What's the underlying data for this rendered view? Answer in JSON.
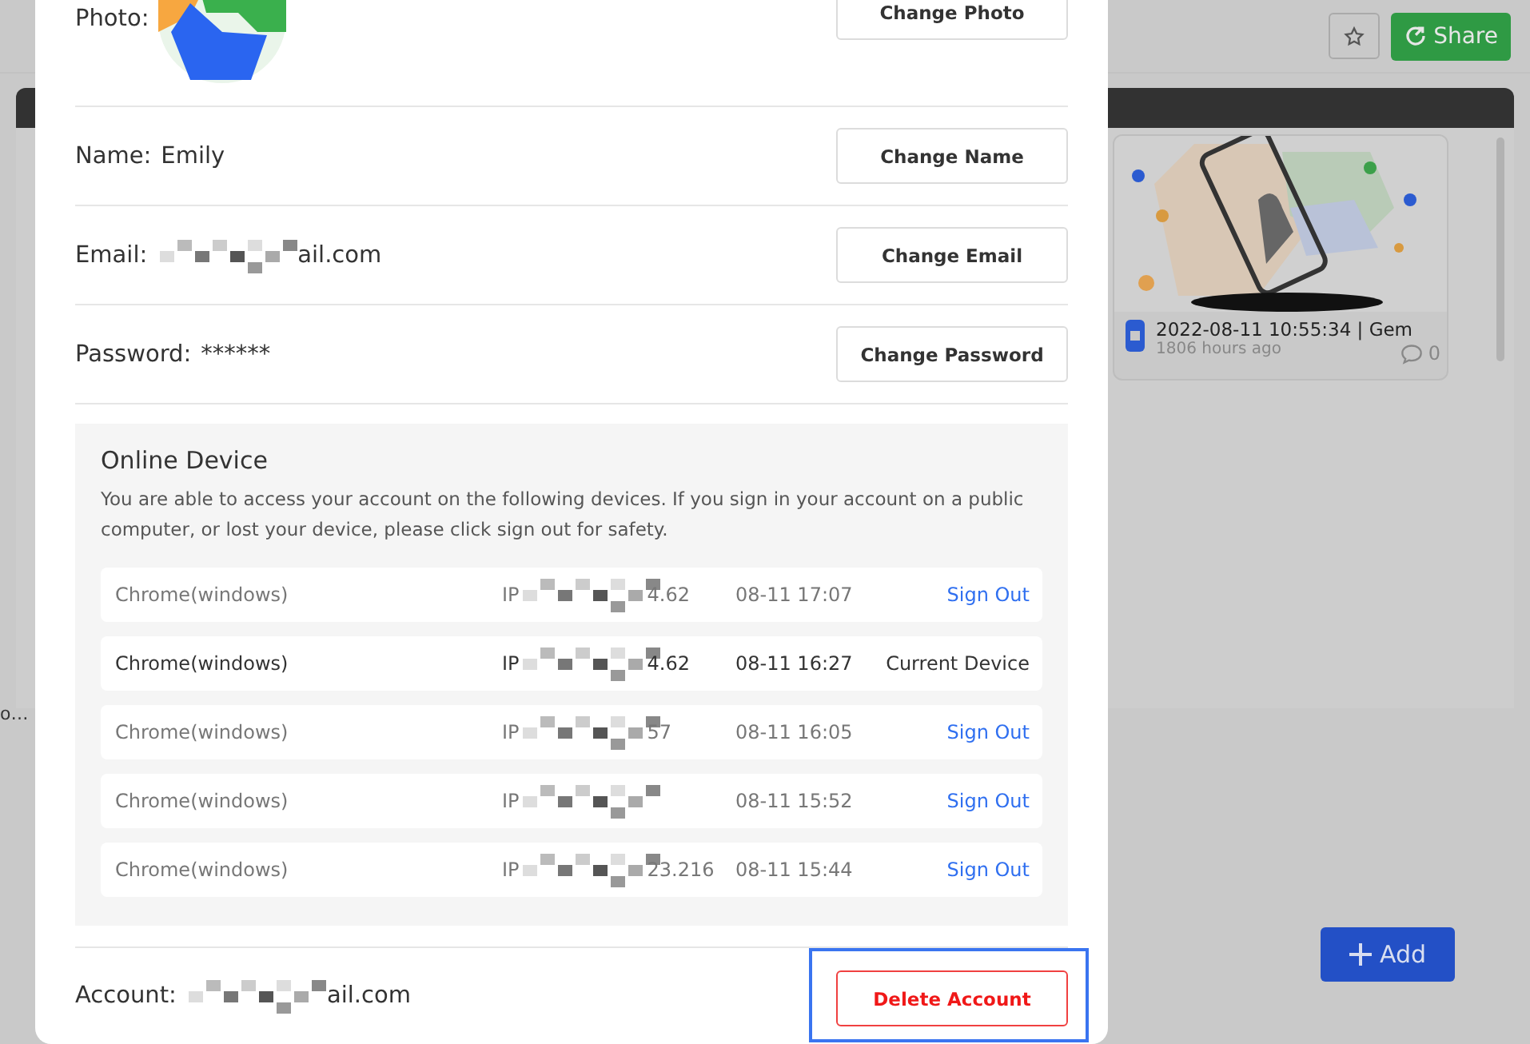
{
  "background": {
    "share_button": "Share",
    "side_text": "o…",
    "add_button": "Add",
    "card": {
      "kind": "picture",
      "title": "2022-08-11 10:55:34 | Gem",
      "time": "1806 hours ago",
      "comments": "0"
    }
  },
  "profile": {
    "rows": [
      {
        "label": "Photo:",
        "button": "Change Photo"
      },
      {
        "kind": "text",
        "label": "Name:",
        "value": "Emily",
        "button": "Change Name"
      },
      {
        "kind": "masked",
        "label": "Email:",
        "value": "ail.com",
        "button": "Change Email"
      },
      {
        "kind": "text",
        "label": "Password:",
        "value": "******",
        "button": "Change Password"
      }
    ]
  },
  "devices": {
    "title": "Online Device",
    "description": "You are able to access your account on the following devices. If you sign in your account on a public computer, or lost your device, please click sign out for safety.",
    "rows": [
      {
        "name": "Chrome(windows)",
        "ip_prefix": "IP",
        "ip_tail": "4.62",
        "time": "08-11 17:07",
        "action": "Sign Out",
        "current": false
      },
      {
        "name": "Chrome(windows)",
        "ip_prefix": "IP",
        "ip_tail": "4.62",
        "time": "08-11 16:27",
        "action": "Current Device",
        "current": true
      },
      {
        "name": "Chrome(windows)",
        "ip_prefix": "IP",
        "ip_tail": "57",
        "time": "08-11 16:05",
        "action": "Sign Out",
        "current": false
      },
      {
        "name": "Chrome(windows)",
        "ip_prefix": "IP",
        "time": "08-11 15:52",
        "action": "Sign Out",
        "current": false
      },
      {
        "name": "Chrome(windows)",
        "ip_prefix": "IP",
        "ip_tail": "23.216",
        "time": "08-11 15:44",
        "action": "Sign Out",
        "current": false
      }
    ]
  },
  "account": {
    "label": "Account:",
    "value": "ail.com",
    "button": "Delete Account",
    "focused": true
  }
}
